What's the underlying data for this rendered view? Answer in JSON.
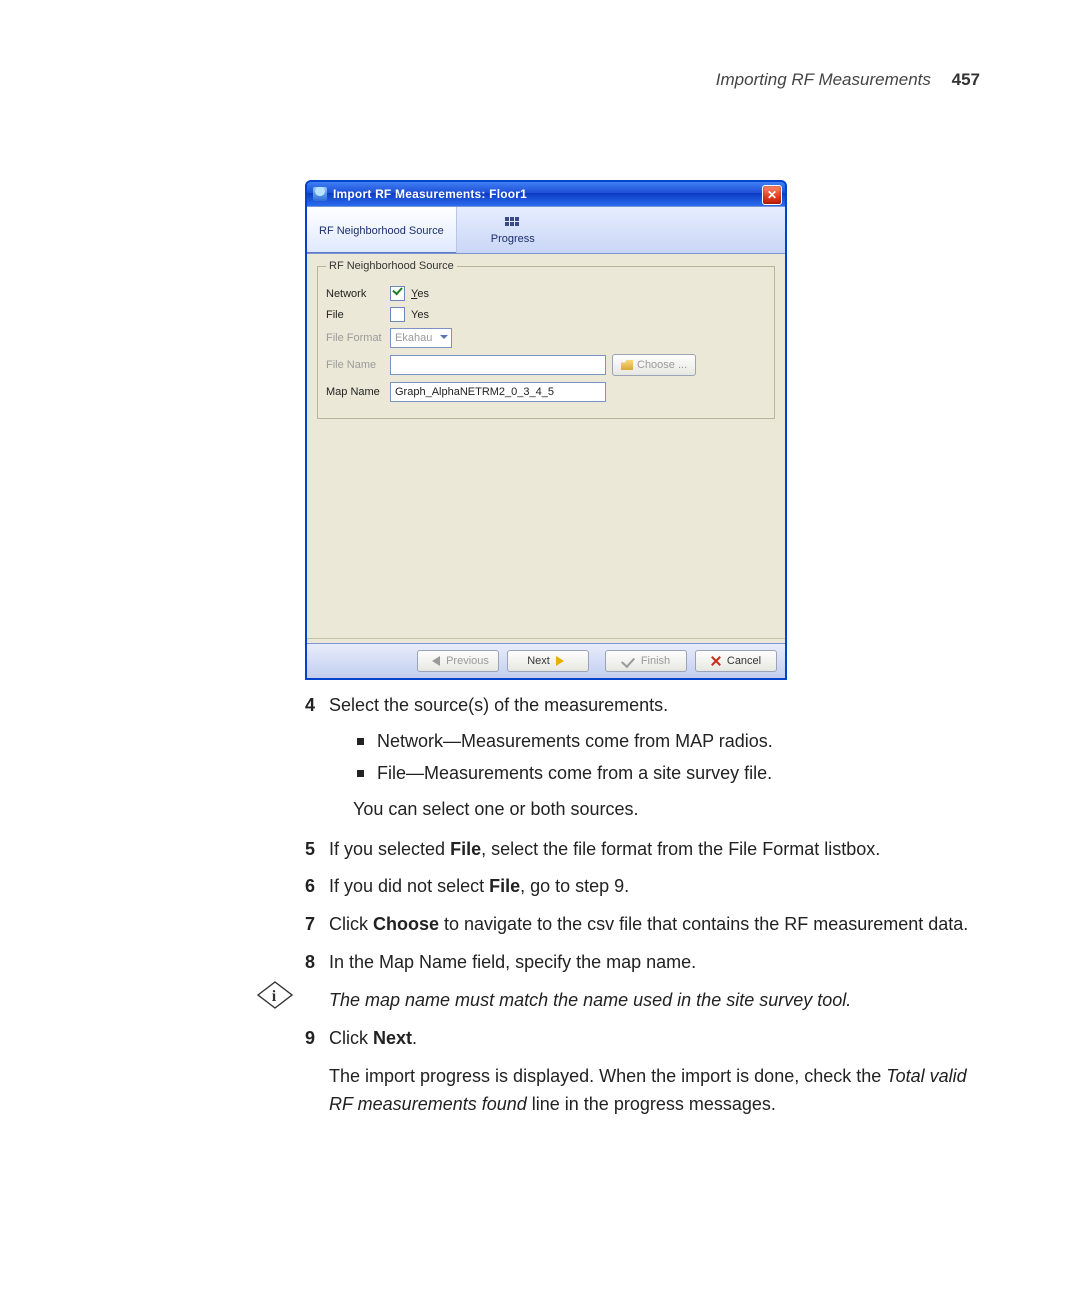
{
  "header": {
    "title": "Importing RF Measurements",
    "page": "457"
  },
  "dialog": {
    "title": "Import RF Measurements: Floor1",
    "tabs": {
      "source": "RF Neighborhood Source",
      "progress": "Progress"
    },
    "fieldset_legend": "RF Neighborhood Source",
    "rows": {
      "network": {
        "label": "Network",
        "option": "Yes"
      },
      "file": {
        "label": "File",
        "option": "Yes"
      },
      "file_format": {
        "label": "File Format",
        "value": "Ekahau"
      },
      "file_name": {
        "label": "File Name",
        "button": "Choose ..."
      },
      "map_name": {
        "label": "Map Name",
        "value": "Graph_AlphaNETRM2_0_3_4_5"
      }
    },
    "footer": {
      "previous": "Previous",
      "next": "Next",
      "finish": "Finish",
      "cancel": "Cancel"
    }
  },
  "doc": {
    "step4": "Select the source(s) of the measurements.",
    "step4_b1": "Network—Measurements come from MAP radios.",
    "step4_b2": "File—Measurements come from a site survey file.",
    "step4_after": "You can select one or both sources.",
    "step5_a": "If you selected ",
    "step5_b": "File",
    "step5_c": ", select the file format from the File Format listbox.",
    "step6_a": "If you did not select ",
    "step6_b": "File",
    "step6_c": ", go to step 9.",
    "step7_a": "Click ",
    "step7_b": "Choose",
    "step7_c": " to navigate to the csv file that contains the RF measurement data.",
    "step8": "In the Map Name field, specify the map name.",
    "note": "The map name must match the name used in the site survey tool.",
    "step9_a": "Click ",
    "step9_b": "Next",
    "step9_c": ".",
    "step9_after_a": "The import progress is displayed. When the import is done, check the ",
    "step9_after_b": "Total valid RF measurements found",
    "step9_after_c": " line in the progress messages."
  }
}
